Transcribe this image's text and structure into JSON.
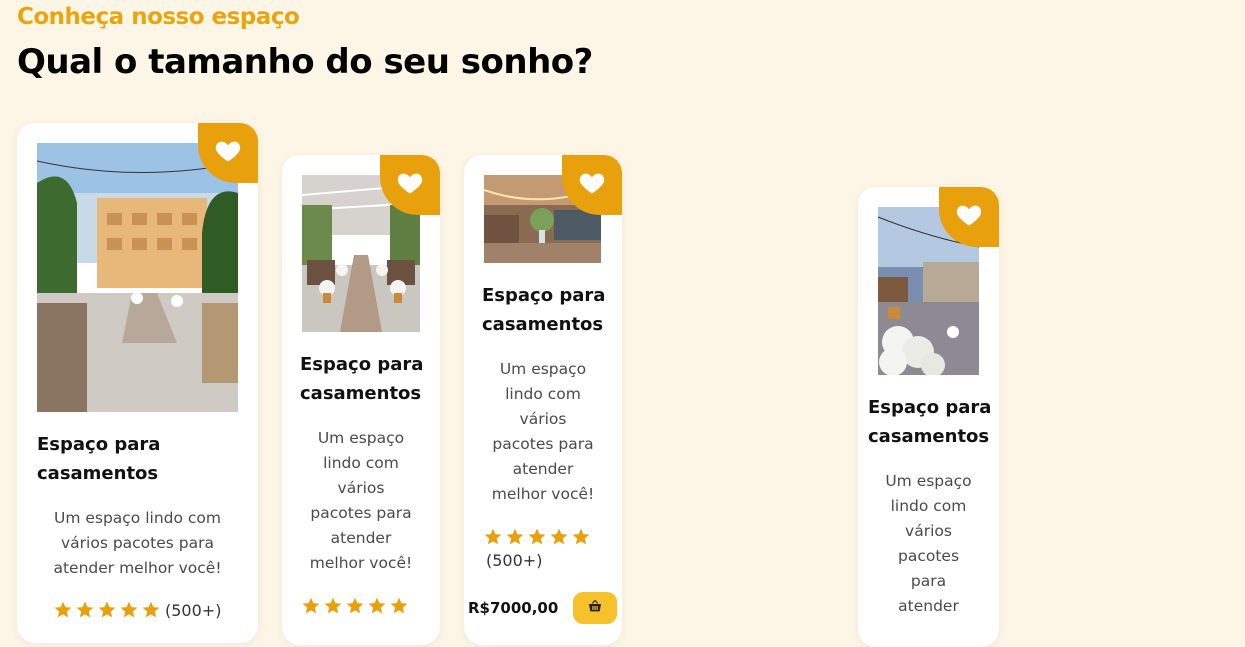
{
  "header": {
    "eyebrow": "Conheça nosso espaço",
    "headline": "Qual o tamanho do seu sonho?"
  },
  "colors": {
    "accent": "#e8a00c",
    "background": "#fdf6e6",
    "star": "#e8a00c",
    "cart_button": "#f5c22b"
  },
  "cards": [
    {
      "title_line1": "Espaço para",
      "title_line2": "casamentos",
      "desc_lines": [
        "Um espaço lindo com",
        "vários pacotes para",
        "atender melhor você!"
      ],
      "rating": 5,
      "rating_count": "(500+)"
    },
    {
      "title_line1": "Espaço para",
      "title_line2": "casamentos",
      "desc_lines": [
        "Um espaço",
        "lindo com",
        "vários",
        "pacotes para",
        "atender",
        "melhor você!"
      ],
      "rating": 5
    },
    {
      "title_line1": "Espaço para",
      "title_line2": "casamentos",
      "desc_lines": [
        "Um espaço",
        "lindo com",
        "vários",
        "pacotes para",
        "atender",
        "melhor você!"
      ],
      "rating": 5,
      "rating_count": "(500+)",
      "price": "R$7000,00"
    },
    {
      "title_line1": "Espaço para",
      "title_line2": "casamentos",
      "desc_lines": [
        "Um espaço",
        "lindo com",
        "vários",
        "pacotes",
        "para",
        "atender"
      ]
    }
  ],
  "icons": {
    "favorite": "heart-icon",
    "rating": "star-icon",
    "cart": "basket-icon"
  }
}
